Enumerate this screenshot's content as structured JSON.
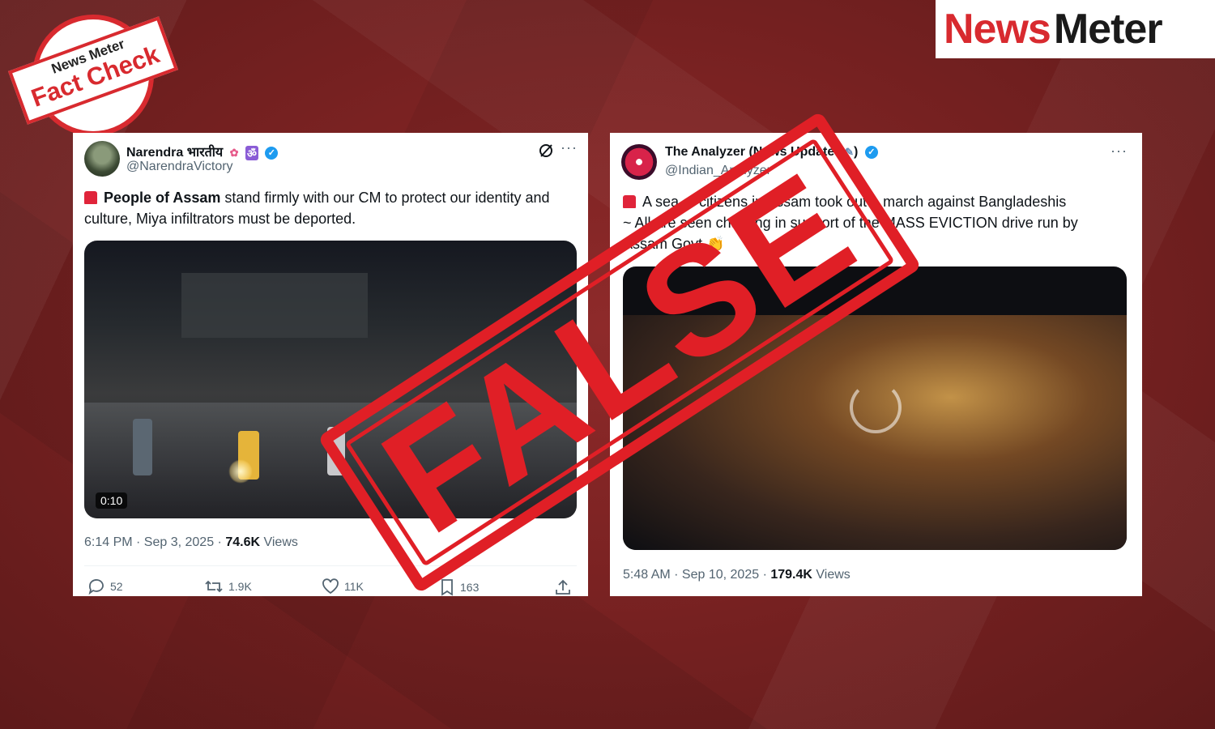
{
  "badge": {
    "brand_news": "News",
    "brand_meter": "Meter",
    "label": "Fact Check"
  },
  "logo": {
    "news": "News",
    "meter": "Meter"
  },
  "stamp": {
    "text": "FALSE"
  },
  "tweet1": {
    "name": "Narendra भारतीय",
    "handle": "@NarendraVictory",
    "text_bold": "People of Assam",
    "text_rest": " stand firmly with our CM to protect our identity and culture, Miya infiltrators must be deported.",
    "duration": "0:10",
    "time": "6:14 PM · Sep 3, 2025 · ",
    "views_count": "74.6K",
    "views_label": " Views",
    "replies": "52",
    "reposts": "1.9K",
    "likes": "11K",
    "bookmarks": "163"
  },
  "tweet2": {
    "name": "The Analyzer (News Updates",
    "name_end": ")",
    "handle": "@Indian_Analyzer",
    "text_line1": "A sea of citizens in Assam took out a march against Bangladeshis",
    "text_line2": "~ All are seen chanting in support of the MASS EVICTION drive run by",
    "text_line3": "Assam Govt",
    "time": "5:48 AM · Sep 10, 2025 · ",
    "views_count": "179.4K",
    "views_label": " Views"
  },
  "colors": {
    "accent": "#d82a2f",
    "stamp": "#e01f26",
    "verified": "#1d9bf0"
  }
}
